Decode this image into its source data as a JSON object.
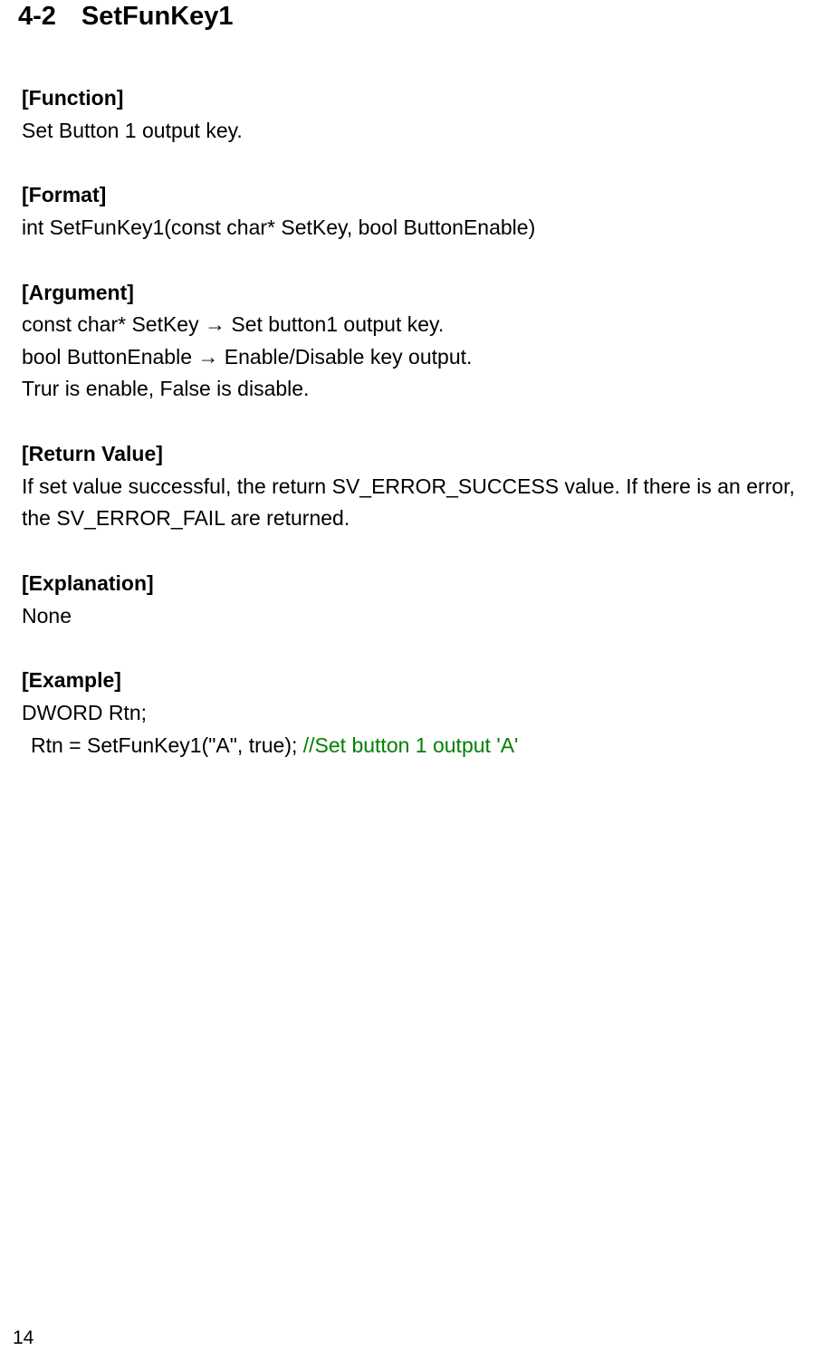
{
  "section": {
    "number": "4-2",
    "title": "SetFunKey1"
  },
  "headings": {
    "function": "[Function]",
    "format": "[Format]",
    "argument": "[Argument]",
    "return_value": "[Return Value]",
    "explanation": "[Explanation]",
    "example": "[Example]"
  },
  "function_text": "Set Button 1 output key.",
  "format_text": "int SetFunKey1(const char* SetKey, bool ButtonEnable)",
  "argument": {
    "line1": "const char* SetKey → Set button1 output key.",
    "line2": "bool ButtonEnable → Enable/Disable key output.",
    "line3": "Trur is enable, False is disable."
  },
  "return_value_text": "If set value successful, the return SV_ERROR_SUCCESS value. If there is an error, the SV_ERROR_FAIL are returned.",
  "explanation_text": "None",
  "example": {
    "line1": "DWORD Rtn;",
    "line2_code": "Rtn = SetFunKey1(\"A\", true); ",
    "line2_comment": "//Set button 1 output 'A'"
  },
  "page_number": "14"
}
